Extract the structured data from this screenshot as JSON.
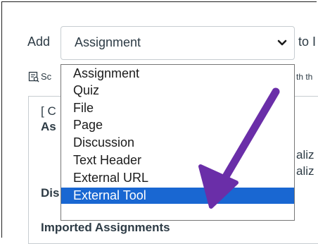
{
  "add_label": "Add",
  "select": {
    "value": "Assignment",
    "icon": "chevron-down-icon"
  },
  "to_label": "to I",
  "search_fragment": "Sc",
  "right_fragment": "th th",
  "background": {
    "line1": "[ C",
    "line2": "As",
    "line3": "Dis",
    "right1": "aliz",
    "right2": "aliz",
    "imported": "Imported Assignments"
  },
  "dropdown": {
    "options": [
      "Assignment",
      "Quiz",
      "File",
      "Page",
      "Discussion",
      "Text Header",
      "External URL",
      "External Tool"
    ],
    "selected_index": 7,
    "selected_color": "#1967d2"
  },
  "annotation": {
    "arrow_color": "#6a2ea8"
  }
}
